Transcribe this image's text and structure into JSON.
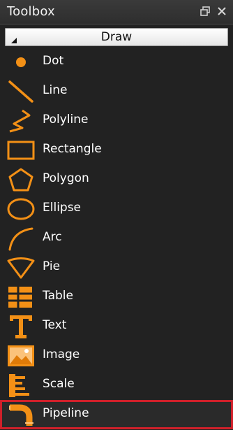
{
  "panel": {
    "title": "Toolbox",
    "float_icon": "restore-window-icon",
    "close_icon": "close-icon"
  },
  "section": {
    "label": "Draw",
    "expand_icon": "collapse-triangle-icon"
  },
  "colors": {
    "accent": "#f39016",
    "background": "#222222",
    "selection_border": "#d0202a"
  },
  "tools": [
    {
      "label": "Dot",
      "icon": "dot-icon"
    },
    {
      "label": "Line",
      "icon": "line-icon"
    },
    {
      "label": "Polyline",
      "icon": "polyline-icon"
    },
    {
      "label": "Rectangle",
      "icon": "rectangle-icon"
    },
    {
      "label": "Polygon",
      "icon": "polygon-icon"
    },
    {
      "label": "Ellipse",
      "icon": "ellipse-icon"
    },
    {
      "label": "Arc",
      "icon": "arc-icon"
    },
    {
      "label": "Pie",
      "icon": "pie-icon"
    },
    {
      "label": "Table",
      "icon": "table-icon"
    },
    {
      "label": "Text",
      "icon": "text-icon"
    },
    {
      "label": "Image",
      "icon": "image-icon"
    },
    {
      "label": "Scale",
      "icon": "scale-icon"
    },
    {
      "label": "Pipeline",
      "icon": "pipeline-icon",
      "selected": true
    }
  ]
}
